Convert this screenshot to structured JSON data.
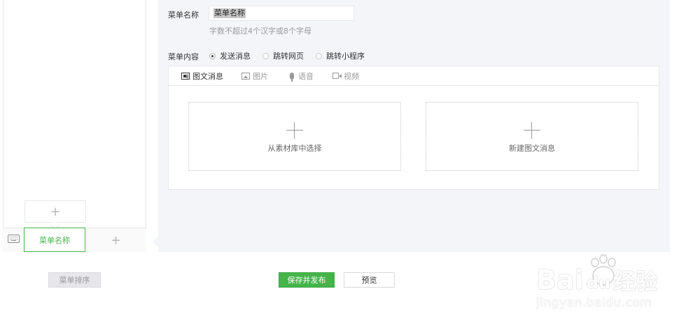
{
  "preview": {
    "sub_add_symbol": "+",
    "menu_item_label": "菜单名称",
    "menu_add_symbol": "+"
  },
  "editor": {
    "name_label": "菜单名称",
    "name_value": "菜单名称",
    "name_hint": "字数不超过4个汉字或8个字母",
    "content_label": "菜单内容",
    "options": [
      {
        "label": "发送消息",
        "selected": true
      },
      {
        "label": "跳转网页",
        "selected": false
      },
      {
        "label": "跳转小程序",
        "selected": false
      }
    ],
    "tabs": [
      {
        "label": "图文消息",
        "icon": "news-icon",
        "active": true
      },
      {
        "label": "图片",
        "icon": "image-icon",
        "active": false
      },
      {
        "label": "语音",
        "icon": "microphone-icon",
        "active": false
      },
      {
        "label": "视频",
        "icon": "video-icon",
        "active": false
      }
    ],
    "pick_from_library": "从素材库中选择",
    "create_news": "新建图文消息"
  },
  "footer": {
    "sort_label": "菜单排序",
    "save_label": "保存并发布",
    "preview_label": "预览"
  },
  "watermark": {
    "logo_prefix": "Bai",
    "logo_du": "du",
    "logo_suffix": "经验",
    "url": "jingyan.baidu.com"
  },
  "colors": {
    "accent": "#44b549",
    "panel_bg": "#f4f5f9",
    "border": "#e7e7eb"
  }
}
